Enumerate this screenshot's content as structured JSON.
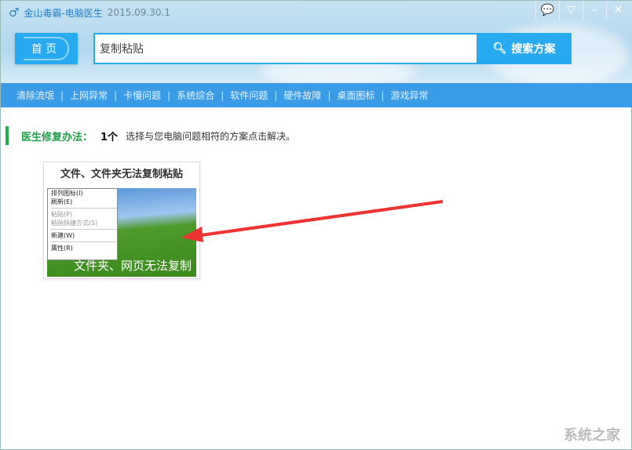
{
  "window": {
    "app": "金山毒霸-电脑医生",
    "version": "2015.09.30.1"
  },
  "header": {
    "home_label": "首 页",
    "search_value": "复制粘贴",
    "search_button": "搜索方案"
  },
  "nav": [
    "清除流氓",
    "上网异常",
    "卡慢问题",
    "系统综合",
    "软件问题",
    "硬件故障",
    "桌面图标",
    "游戏异常"
  ],
  "result": {
    "label": "医生修复办法：",
    "count": "1个",
    "hint": "选择与您电脑问题相符的方案点击解决。"
  },
  "card": {
    "title": "文件、文件夹无法复制粘贴",
    "caption": "文件夹、网页无法复制",
    "menu": [
      "排列图标(I)",
      "刷新(E)",
      "粘贴(P)",
      "粘贴快捷方式(S)",
      "新建(W)",
      "属性(R)"
    ]
  },
  "watermark": "系统之家"
}
